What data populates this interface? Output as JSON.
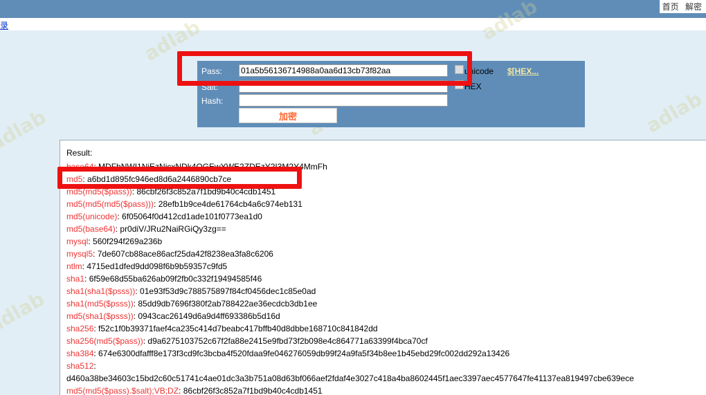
{
  "header": {
    "links": [
      "首页",
      "解密"
    ]
  },
  "subnav": {
    "link": "录"
  },
  "watermark": "adlab",
  "form": {
    "pass_label": "Pass:",
    "pass_value": "01a5b56136714988a0aa6d13cb73f82aa",
    "salt_label": "Salt:",
    "salt_value": "",
    "hash_label": "Hash:",
    "hash_value": "",
    "unicode_label": "unicode",
    "hex_label": "HEX",
    "hex_link": "$[HEX...",
    "submit_label": "加密"
  },
  "results": {
    "title": "Result:",
    "rows": [
      {
        "name": "base64",
        "value": "MDFhNWI1NjEzNjcxNDk4OGEwYWE2ZDEzY2I3M2Y4MmFh"
      },
      {
        "name": "md5",
        "value": "a6bd1d895fc946ed8d6a2446890cb7ce"
      },
      {
        "name": "md5(md5($pass))",
        "value": "86cbf26f3c852a7f1bd9b40c4cdb1451"
      },
      {
        "name": "md5(md5(md5($pass)))",
        "value": "28efb1b9ce4de61764cb4a6c974eb131"
      },
      {
        "name": "md5(unicode)",
        "value": "6f05064f0d412cd1ade101f0773ea1d0"
      },
      {
        "name": "md5(base64)",
        "value": "pr0diV/JRu2NaiRGiQy3zg=="
      },
      {
        "name": "mysql",
        "value": "560f294f269a236b"
      },
      {
        "name": "mysql5",
        "value": "7de607cb88ace86acf25da42f8238ea3fa8c6206"
      },
      {
        "name": "ntlm",
        "value": "4715ed1dfed9dd098f6b9b59357c9fd5"
      },
      {
        "name": "sha1",
        "value": "6f59e68d55ba626ab09f2fb0c332f19494585f46"
      },
      {
        "name": "sha1(sha1($psss))",
        "value": "01e93f53d9c788575897f84cf0456dec1c85e0ad"
      },
      {
        "name": "sha1(md5($psss))",
        "value": "85dd9db7696f380f2ab788422ae36ecdcb3db1ee"
      },
      {
        "name": "md5(sha1($psss))",
        "value": "0943cac26149d6a9d4ff693386b5d16d"
      },
      {
        "name": "sha256",
        "value": "f52c1f0b39371faef4ca235c414d7beabc417bffb40d8dbbe168710c841842dd"
      },
      {
        "name": "sha256(md5($pass))",
        "value": "d9a6275103752c67f2fa88e2415e9fbd73f2b098e4c864771a63399f4bca70cf"
      },
      {
        "name": "sha384",
        "value": "674e6300dfafff8e173f3cd9fc3bcba4f520fdaa9fe046276059db99f24a9fa5f34b8ee1b45ebd29fc002dd292a13426"
      },
      {
        "name": "sha512",
        "value": ""
      },
      {
        "name": "",
        "value": "d460a38be34603c15bd2c60c51741c4ae01dc3a3b751a08d63bf066aef2fdaf4e3027c418a4ba8602445f1aec3397aec4577647fe41137ea819497cbe639ece"
      },
      {
        "name": "md5(md5($pass).$salt);VB;DZ",
        "value": "86cbf26f3c852a7f1bd9b40c4cdb1451"
      }
    ]
  },
  "colors": {
    "panel": "#5f8db8",
    "background": "#e2eef6",
    "result_name": "#ee3333",
    "highlight": "#ee1111",
    "submit_text": "#ff6633"
  }
}
